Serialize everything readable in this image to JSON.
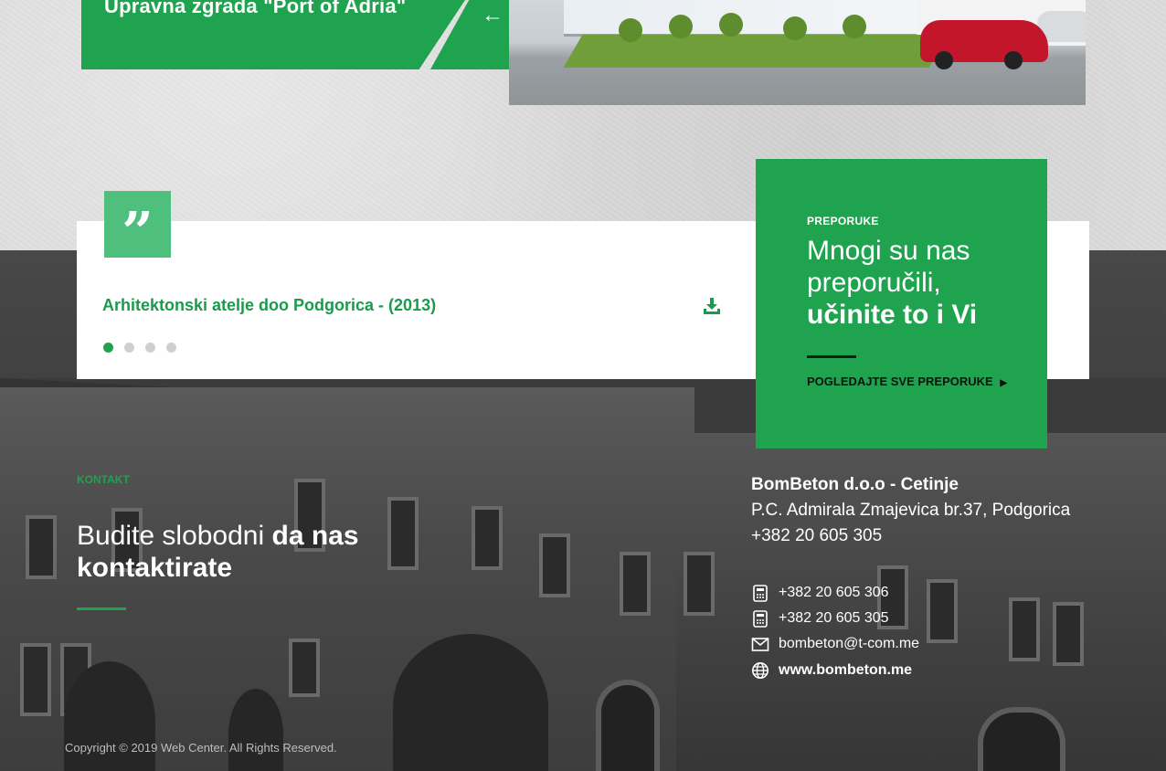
{
  "project": {
    "title": "Upravna zgrada \"Port of Adria\"",
    "prev_icon": "arrow-left-icon",
    "next_icon": "arrow-right-icon"
  },
  "testimonial": {
    "quote_icon": "quote-icon",
    "text": "Arhitektonski atelje doo Podgorica - (2013)",
    "download_icon": "download-icon",
    "dots": 4,
    "active_dot": 0
  },
  "recommendations": {
    "label": "PREPORUKE",
    "heading_line1": "Mnogi su nas",
    "heading_line2": "preporučili,",
    "heading_bold": "učinite to i Vi",
    "link": "POGLEDAJTE SVE PREPORUKE"
  },
  "contact": {
    "label": "KONTAKT",
    "heading_normal": "Budite slobodni",
    "heading_bold1": "da nas",
    "heading_bold2": "kontaktirate",
    "company_name": "BomBeton d.o.o - Cetinje",
    "address": "P.C. Admirala Zmajevica br.37, Podgorica",
    "main_phone": "+382 20 605 305",
    "phone1": "+382 20 605 306",
    "phone2": "+382 20 605 305",
    "email": "bombeton@t-com.me",
    "website": "www.bombeton.me"
  },
  "footer": {
    "copyright": "Copyright © 2019 Web Center. All Rights Reserved."
  },
  "colors": {
    "brand_green": "#1fa34e",
    "quote_green": "#4fbf7d",
    "dark_bg": "#3b3b3b"
  }
}
